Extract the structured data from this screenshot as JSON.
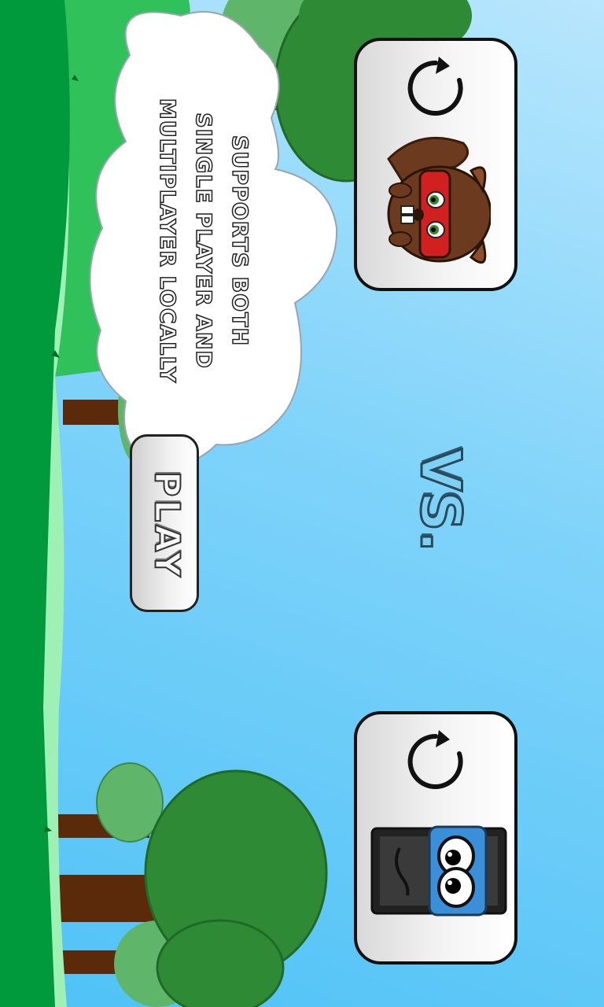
{
  "speech_bubble": {
    "line1": "SUPPORTS BOTH",
    "line2": "SINGLE PLAYER AND",
    "line3": "MULTIPLAYER LOCALLY"
  },
  "vs_label": "VS.",
  "play_button": {
    "label": "PLAY"
  },
  "player1": {
    "character": "beaver",
    "icon": "refresh-icon"
  },
  "player2": {
    "character": "tv-monster",
    "icon": "refresh-icon"
  },
  "colors": {
    "sky": "#7fd3fa",
    "grass_dark": "#009a3c",
    "grass_light": "#9ef0b4",
    "tree_green": "#2f8a36",
    "tree_trunk": "#5a2a0a",
    "bandana_red": "#d21f1f",
    "tv_blue": "#3a8fd8"
  }
}
